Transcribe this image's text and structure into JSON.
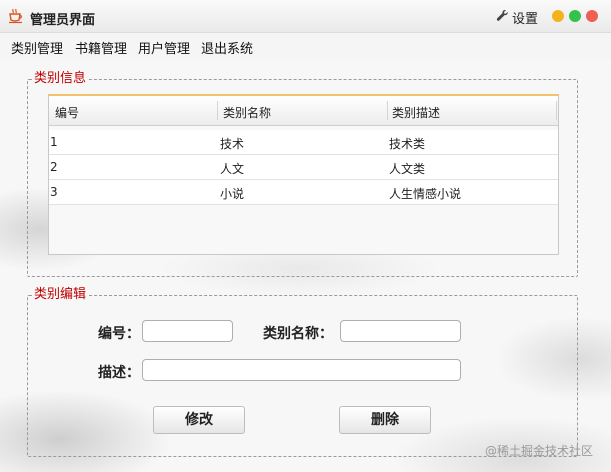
{
  "window": {
    "title": "管理员界面",
    "settings_label": "设置",
    "controls": {
      "minimize_color": "#f5b21c",
      "maximize_color": "#35c24a",
      "close_color": "#f05f57"
    }
  },
  "menu": {
    "items": [
      {
        "label": "类别管理"
      },
      {
        "label": "书籍管理"
      },
      {
        "label": "用户管理"
      },
      {
        "label": "退出系统"
      }
    ]
  },
  "category_info": {
    "legend": "类别信息",
    "columns": [
      "编号",
      "类别名称",
      "类别描述"
    ],
    "rows": [
      {
        "id": "1",
        "name": "技术",
        "desc": "技术类"
      },
      {
        "id": "2",
        "name": "人文",
        "desc": "人文类"
      },
      {
        "id": "3",
        "name": "小说",
        "desc": "人生情感小说"
      }
    ]
  },
  "category_edit": {
    "legend": "类别编辑",
    "id_label": "编号：",
    "id_value": "",
    "name_label": "类别名称：",
    "name_value": "",
    "desc_label": "描述：",
    "desc_value": "",
    "modify_button": "修改",
    "delete_button": "删除"
  },
  "watermark": "@稀土掘金技术社区",
  "colors": {
    "legend_red": "#c00000",
    "table_top_accent": "#f0c36a"
  }
}
